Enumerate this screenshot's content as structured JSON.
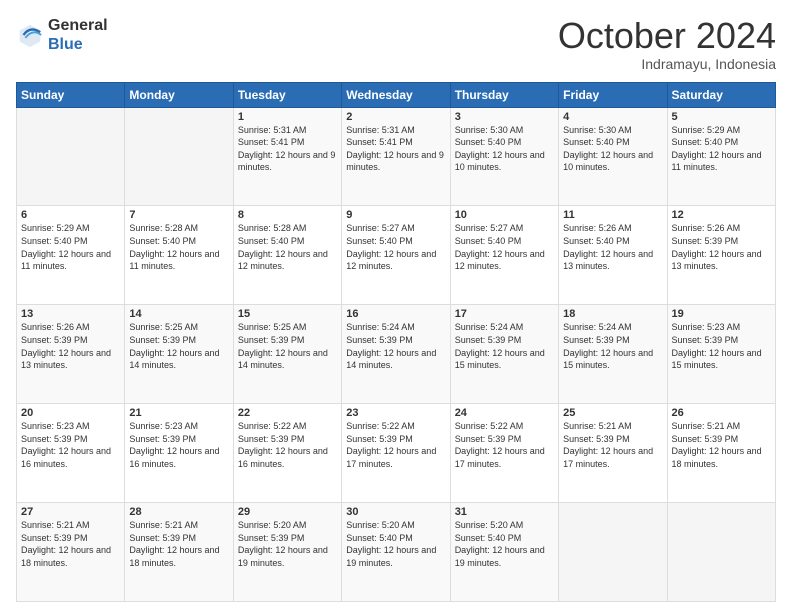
{
  "logo": {
    "general": "General",
    "blue": "Blue"
  },
  "header": {
    "month_year": "October 2024",
    "location": "Indramayu, Indonesia"
  },
  "weekdays": [
    "Sunday",
    "Monday",
    "Tuesday",
    "Wednesday",
    "Thursday",
    "Friday",
    "Saturday"
  ],
  "weeks": [
    [
      {
        "day": "",
        "sunrise": "",
        "sunset": "",
        "daylight": ""
      },
      {
        "day": "",
        "sunrise": "",
        "sunset": "",
        "daylight": ""
      },
      {
        "day": "1",
        "sunrise": "Sunrise: 5:31 AM",
        "sunset": "Sunset: 5:41 PM",
        "daylight": "Daylight: 12 hours and 9 minutes."
      },
      {
        "day": "2",
        "sunrise": "Sunrise: 5:31 AM",
        "sunset": "Sunset: 5:41 PM",
        "daylight": "Daylight: 12 hours and 9 minutes."
      },
      {
        "day": "3",
        "sunrise": "Sunrise: 5:30 AM",
        "sunset": "Sunset: 5:40 PM",
        "daylight": "Daylight: 12 hours and 10 minutes."
      },
      {
        "day": "4",
        "sunrise": "Sunrise: 5:30 AM",
        "sunset": "Sunset: 5:40 PM",
        "daylight": "Daylight: 12 hours and 10 minutes."
      },
      {
        "day": "5",
        "sunrise": "Sunrise: 5:29 AM",
        "sunset": "Sunset: 5:40 PM",
        "daylight": "Daylight: 12 hours and 11 minutes."
      }
    ],
    [
      {
        "day": "6",
        "sunrise": "Sunrise: 5:29 AM",
        "sunset": "Sunset: 5:40 PM",
        "daylight": "Daylight: 12 hours and 11 minutes."
      },
      {
        "day": "7",
        "sunrise": "Sunrise: 5:28 AM",
        "sunset": "Sunset: 5:40 PM",
        "daylight": "Daylight: 12 hours and 11 minutes."
      },
      {
        "day": "8",
        "sunrise": "Sunrise: 5:28 AM",
        "sunset": "Sunset: 5:40 PM",
        "daylight": "Daylight: 12 hours and 12 minutes."
      },
      {
        "day": "9",
        "sunrise": "Sunrise: 5:27 AM",
        "sunset": "Sunset: 5:40 PM",
        "daylight": "Daylight: 12 hours and 12 minutes."
      },
      {
        "day": "10",
        "sunrise": "Sunrise: 5:27 AM",
        "sunset": "Sunset: 5:40 PM",
        "daylight": "Daylight: 12 hours and 12 minutes."
      },
      {
        "day": "11",
        "sunrise": "Sunrise: 5:26 AM",
        "sunset": "Sunset: 5:40 PM",
        "daylight": "Daylight: 12 hours and 13 minutes."
      },
      {
        "day": "12",
        "sunrise": "Sunrise: 5:26 AM",
        "sunset": "Sunset: 5:39 PM",
        "daylight": "Daylight: 12 hours and 13 minutes."
      }
    ],
    [
      {
        "day": "13",
        "sunrise": "Sunrise: 5:26 AM",
        "sunset": "Sunset: 5:39 PM",
        "daylight": "Daylight: 12 hours and 13 minutes."
      },
      {
        "day": "14",
        "sunrise": "Sunrise: 5:25 AM",
        "sunset": "Sunset: 5:39 PM",
        "daylight": "Daylight: 12 hours and 14 minutes."
      },
      {
        "day": "15",
        "sunrise": "Sunrise: 5:25 AM",
        "sunset": "Sunset: 5:39 PM",
        "daylight": "Daylight: 12 hours and 14 minutes."
      },
      {
        "day": "16",
        "sunrise": "Sunrise: 5:24 AM",
        "sunset": "Sunset: 5:39 PM",
        "daylight": "Daylight: 12 hours and 14 minutes."
      },
      {
        "day": "17",
        "sunrise": "Sunrise: 5:24 AM",
        "sunset": "Sunset: 5:39 PM",
        "daylight": "Daylight: 12 hours and 15 minutes."
      },
      {
        "day": "18",
        "sunrise": "Sunrise: 5:24 AM",
        "sunset": "Sunset: 5:39 PM",
        "daylight": "Daylight: 12 hours and 15 minutes."
      },
      {
        "day": "19",
        "sunrise": "Sunrise: 5:23 AM",
        "sunset": "Sunset: 5:39 PM",
        "daylight": "Daylight: 12 hours and 15 minutes."
      }
    ],
    [
      {
        "day": "20",
        "sunrise": "Sunrise: 5:23 AM",
        "sunset": "Sunset: 5:39 PM",
        "daylight": "Daylight: 12 hours and 16 minutes."
      },
      {
        "day": "21",
        "sunrise": "Sunrise: 5:23 AM",
        "sunset": "Sunset: 5:39 PM",
        "daylight": "Daylight: 12 hours and 16 minutes."
      },
      {
        "day": "22",
        "sunrise": "Sunrise: 5:22 AM",
        "sunset": "Sunset: 5:39 PM",
        "daylight": "Daylight: 12 hours and 16 minutes."
      },
      {
        "day": "23",
        "sunrise": "Sunrise: 5:22 AM",
        "sunset": "Sunset: 5:39 PM",
        "daylight": "Daylight: 12 hours and 17 minutes."
      },
      {
        "day": "24",
        "sunrise": "Sunrise: 5:22 AM",
        "sunset": "Sunset: 5:39 PM",
        "daylight": "Daylight: 12 hours and 17 minutes."
      },
      {
        "day": "25",
        "sunrise": "Sunrise: 5:21 AM",
        "sunset": "Sunset: 5:39 PM",
        "daylight": "Daylight: 12 hours and 17 minutes."
      },
      {
        "day": "26",
        "sunrise": "Sunrise: 5:21 AM",
        "sunset": "Sunset: 5:39 PM",
        "daylight": "Daylight: 12 hours and 18 minutes."
      }
    ],
    [
      {
        "day": "27",
        "sunrise": "Sunrise: 5:21 AM",
        "sunset": "Sunset: 5:39 PM",
        "daylight": "Daylight: 12 hours and 18 minutes."
      },
      {
        "day": "28",
        "sunrise": "Sunrise: 5:21 AM",
        "sunset": "Sunset: 5:39 PM",
        "daylight": "Daylight: 12 hours and 18 minutes."
      },
      {
        "day": "29",
        "sunrise": "Sunrise: 5:20 AM",
        "sunset": "Sunset: 5:39 PM",
        "daylight": "Daylight: 12 hours and 19 minutes."
      },
      {
        "day": "30",
        "sunrise": "Sunrise: 5:20 AM",
        "sunset": "Sunset: 5:40 PM",
        "daylight": "Daylight: 12 hours and 19 minutes."
      },
      {
        "day": "31",
        "sunrise": "Sunrise: 5:20 AM",
        "sunset": "Sunset: 5:40 PM",
        "daylight": "Daylight: 12 hours and 19 minutes."
      },
      {
        "day": "",
        "sunrise": "",
        "sunset": "",
        "daylight": ""
      },
      {
        "day": "",
        "sunrise": "",
        "sunset": "",
        "daylight": ""
      }
    ]
  ]
}
